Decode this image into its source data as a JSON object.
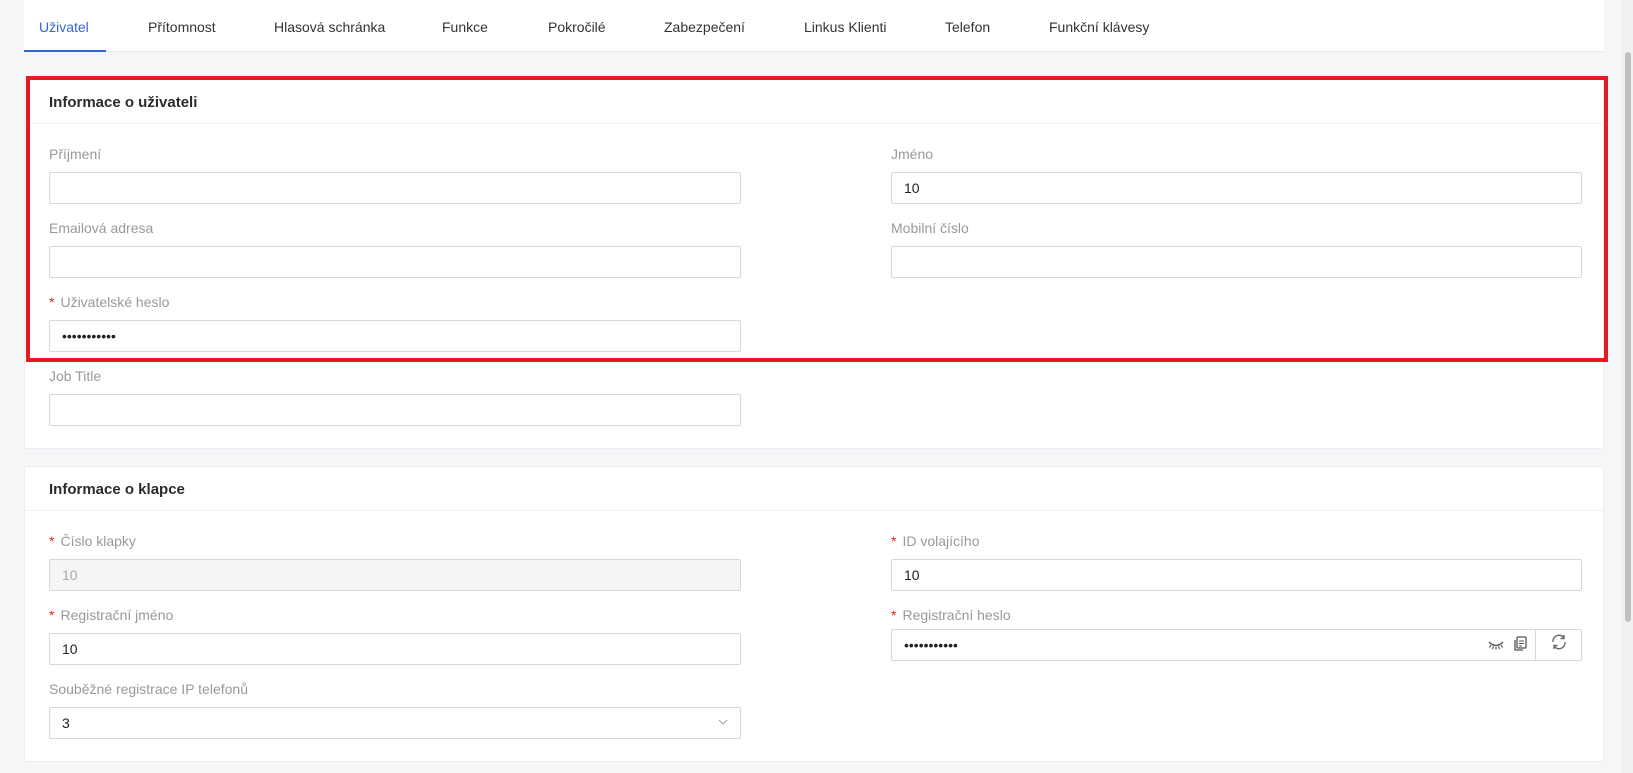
{
  "tabs": [
    {
      "label": "Uživatel",
      "active": true
    },
    {
      "label": "Přítomnost"
    },
    {
      "label": "Hlasová schránka"
    },
    {
      "label": "Funkce"
    },
    {
      "label": "Pokročilé"
    },
    {
      "label": "Zabezpečení"
    },
    {
      "label": "Linkus Klienti"
    },
    {
      "label": "Telefon"
    },
    {
      "label": "Funkční klávesy"
    }
  ],
  "user_info": {
    "title": "Informace o uživateli",
    "last_name": {
      "label": "Příjmení",
      "value": ""
    },
    "first_name": {
      "label": "Jméno",
      "value": "10"
    },
    "email": {
      "label": "Emailová adresa",
      "value": ""
    },
    "mobile": {
      "label": "Mobilní číslo",
      "value": ""
    },
    "user_password": {
      "label": "Uživatelské heslo",
      "required_mark": "*",
      "value": "•••••••••••"
    },
    "job_title": {
      "label": "Job Title",
      "value": ""
    }
  },
  "extension_info": {
    "title": "Informace o klapce",
    "extension_number": {
      "label": "Číslo klapky",
      "required_mark": "*",
      "value": "10"
    },
    "caller_id": {
      "label": "ID volajícího",
      "required_mark": "*",
      "value": "10"
    },
    "registration_name": {
      "label": "Registrační jméno",
      "required_mark": "*",
      "value": "10"
    },
    "registration_password": {
      "label": "Registrační heslo",
      "required_mark": "*",
      "value": "•••••••••••"
    },
    "concurrent_registrations": {
      "label": "Souběžné registrace IP telefonů",
      "value": "3"
    }
  },
  "icons": {
    "password_toggle": "eye-closed-icon",
    "copy": "copy-icon",
    "refresh": "refresh-icon",
    "dropdown": "chevron-down-icon"
  },
  "colors": {
    "accent": "#3367d6",
    "highlight_border": "#e41b23",
    "required": "#e0271a"
  }
}
